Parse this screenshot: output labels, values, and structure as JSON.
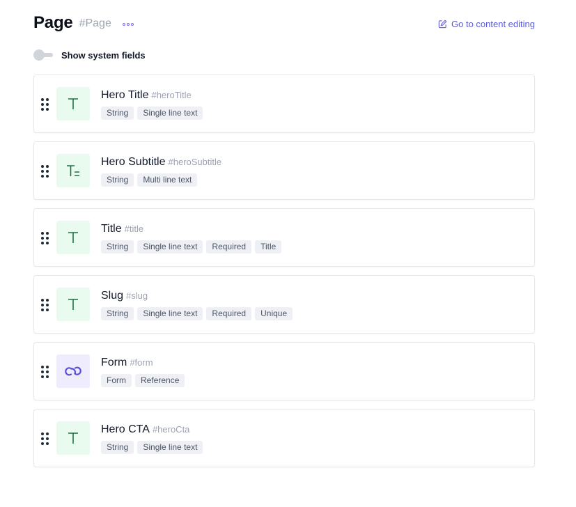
{
  "header": {
    "title": "Page",
    "api_id": "#Page",
    "more_icon": "more-horizontal-icon",
    "edit_link_label": "Go to content editing",
    "edit_icon": "edit-icon",
    "accent_color": "#5b5bd6"
  },
  "system_fields": {
    "label": "Show system fields",
    "enabled": false
  },
  "fields": [
    {
      "name": "Hero Title",
      "api_id": "#heroTitle",
      "icon": "single-line-text-icon",
      "icon_color": "green",
      "tags": [
        "String",
        "Single line text"
      ]
    },
    {
      "name": "Hero Subtitle",
      "api_id": "#heroSubtitle",
      "icon": "multi-line-text-icon",
      "icon_color": "green",
      "tags": [
        "String",
        "Multi line text"
      ]
    },
    {
      "name": "Title",
      "api_id": "#title",
      "icon": "single-line-text-icon",
      "icon_color": "green",
      "tags": [
        "String",
        "Single line text",
        "Required",
        "Title"
      ]
    },
    {
      "name": "Slug",
      "api_id": "#slug",
      "icon": "single-line-text-icon",
      "icon_color": "green",
      "tags": [
        "String",
        "Single line text",
        "Required",
        "Unique"
      ]
    },
    {
      "name": "Form",
      "api_id": "#form",
      "icon": "link-icon",
      "icon_color": "purple",
      "tags": [
        "Form",
        "Reference"
      ]
    },
    {
      "name": "Hero CTA",
      "api_id": "#heroCta",
      "icon": "single-line-text-icon",
      "icon_color": "green",
      "tags": [
        "String",
        "Single line text"
      ]
    }
  ]
}
